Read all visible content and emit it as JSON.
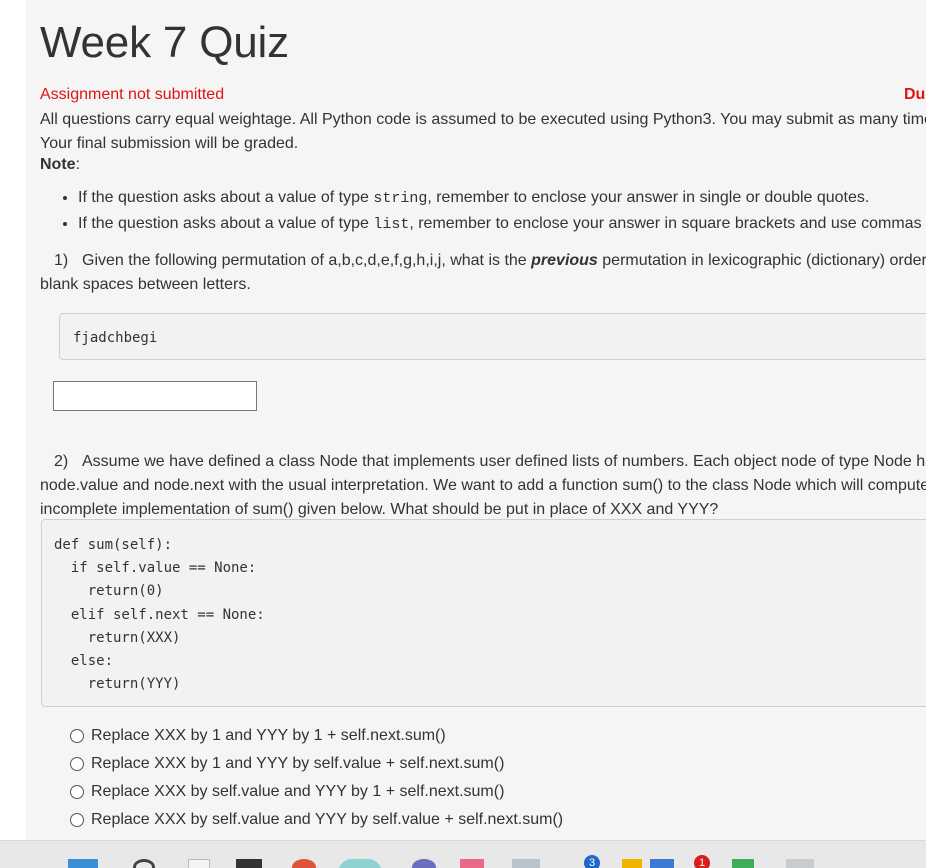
{
  "quiz": {
    "title": "Week 7 Quiz",
    "status": "Assignment not submitted",
    "due_label": "Du",
    "intro_line1": "All questions carry equal weightage. All Python code is assumed to be executed using Python3. You may submit as many times",
    "intro_line2": "Your final submission will be graded.",
    "note_label": "Note",
    "notes": [
      {
        "pre": "If the question asks about a value of type ",
        "code": "string",
        "post": ", remember to enclose your answer in single or double quotes."
      },
      {
        "pre": "If the question asks about a value of type ",
        "code": "list",
        "post": ", remember to enclose your answer in square brackets and use commas to"
      }
    ]
  },
  "q1": {
    "number": "1)",
    "text_pre": "Given the following permutation of a,b,c,d,e,f,g,h,i,j, what is the ",
    "text_emph": "previous",
    "text_post": " permutation in lexicographic (dictionary) order?",
    "text_line2": "blank spaces between letters.",
    "code": "fjadchbegi",
    "answer_value": ""
  },
  "q2": {
    "number": "2)",
    "line1": "Assume we have defined a class Node that implements user defined lists of numbers. Each object node of type Node has",
    "line2": "node.value and node.next with the usual interpretation. We want to add a function sum() to the class Node which will compute t",
    "line3": "incomplete implementation of sum() given below. What should be put in place of XXX and YYY?",
    "code": "def sum(self):\n  if self.value == None:\n    return(0)\n  elif self.next == None:\n    return(XXX)\n  else:\n    return(YYY)",
    "options": [
      "Replace XXX by 1 and YYY by 1 + self.next.sum()",
      "Replace XXX by 1 and YYY by self.value + self.next.sum()",
      "Replace XXX by self.value and YYY by 1 + self.next.sum()",
      "Replace XXX by self.value and YYY by self.value + self.next.sum()"
    ]
  },
  "taskbar": {
    "badge_left": "3",
    "badge_right": "1"
  },
  "colors": {
    "status_red": "#e01414",
    "page_bg": "#f5f5f5"
  }
}
